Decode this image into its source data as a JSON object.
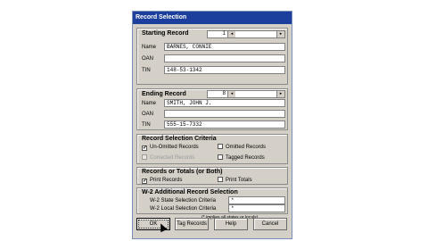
{
  "window": {
    "title": "Record Selection"
  },
  "starting": {
    "title": "Starting Record",
    "number": "1",
    "name_label": "Name",
    "name_value": "BARNES, CONNIE",
    "oan_label": "OAN",
    "oan_value": "",
    "tin_label": "TIN",
    "tin_value": "148-53-1342"
  },
  "ending": {
    "title": "Ending Record",
    "number": "8",
    "name_label": "Name",
    "name_value": "SMITH, JOHN J.",
    "oan_label": "OAN",
    "oan_value": "",
    "tin_label": "TIN",
    "tin_value": "555-15-7332"
  },
  "criteria": {
    "title": "Record Selection Criteria",
    "unomitted": "Un-Omitted Records",
    "omitted": "Omitted Records",
    "corrected": "Corrected Records",
    "tagged": "Tagged Records"
  },
  "totals": {
    "title": "Records or Totals (or Both)",
    "print_records": "Print Records",
    "print_totals": "Print Totals"
  },
  "w2": {
    "title": "W-2 Additional Record Selection",
    "state_label": "W-2 State Selection Criteria",
    "state_value": "*",
    "local_label": "W-2 Local Selection Criteria",
    "local_value": "*",
    "note": "(* implies all states or locals)"
  },
  "buttons": {
    "ok": "OK",
    "tag": "Tag Records",
    "help": "Help",
    "cancel": "Cancel"
  }
}
